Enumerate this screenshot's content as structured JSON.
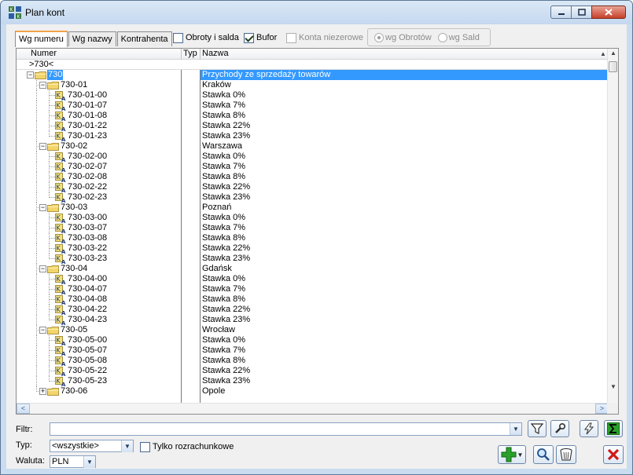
{
  "window": {
    "title": "Plan kont",
    "icon": "app-grid-icon"
  },
  "tabs": [
    {
      "label": "Wg numeru",
      "active": true
    },
    {
      "label": "Wg nazwy",
      "active": false
    },
    {
      "label": "Kontrahenta",
      "active": false
    }
  ],
  "options": {
    "obroty": {
      "label": "Obroty i salda",
      "checked": false
    },
    "bufor": {
      "label": "Bufor",
      "checked": true
    },
    "niezerowe": {
      "label": "Konta niezerowe",
      "checked": false,
      "disabled": true
    },
    "wg_obrotow": {
      "label": "wg Obrotów",
      "selected": true,
      "disabled": true
    },
    "wg_sald": {
      "label": "wg Sald",
      "selected": false,
      "disabled": true
    }
  },
  "grid": {
    "columns": {
      "numer": "Numer",
      "typ": "Typ",
      "nazwa": "Nazwa"
    },
    "filter_value": ">730<",
    "rows": [
      {
        "level": 0,
        "kind": "folder",
        "expander": "−",
        "numer": "730",
        "nazwa": "Przychody ze sprzedaży towarów",
        "selected": true
      },
      {
        "level": 1,
        "kind": "folder",
        "expander": "−",
        "numer": "730-01",
        "nazwa": "Kraków"
      },
      {
        "level": 2,
        "kind": "account",
        "numer": "730-01-00",
        "nazwa": "Stawka 0%"
      },
      {
        "level": 2,
        "kind": "account",
        "numer": "730-01-07",
        "nazwa": "Stawka 7%"
      },
      {
        "level": 2,
        "kind": "account",
        "numer": "730-01-08",
        "nazwa": "Stawka 8%"
      },
      {
        "level": 2,
        "kind": "account",
        "numer": "730-01-22",
        "nazwa": "Stawka 22%"
      },
      {
        "level": 2,
        "kind": "account",
        "numer": "730-01-23",
        "nazwa": "Stawka 23%",
        "last": true
      },
      {
        "level": 1,
        "kind": "folder",
        "expander": "−",
        "numer": "730-02",
        "nazwa": "Warszawa"
      },
      {
        "level": 2,
        "kind": "account",
        "numer": "730-02-00",
        "nazwa": "Stawka 0%"
      },
      {
        "level": 2,
        "kind": "account",
        "numer": "730-02-07",
        "nazwa": "Stawka 7%"
      },
      {
        "level": 2,
        "kind": "account",
        "numer": "730-02-08",
        "nazwa": "Stawka 8%"
      },
      {
        "level": 2,
        "kind": "account",
        "numer": "730-02-22",
        "nazwa": "Stawka 22%"
      },
      {
        "level": 2,
        "kind": "account",
        "numer": "730-02-23",
        "nazwa": "Stawka 23%",
        "last": true
      },
      {
        "level": 1,
        "kind": "folder",
        "expander": "−",
        "numer": "730-03",
        "nazwa": "Poznań"
      },
      {
        "level": 2,
        "kind": "account",
        "numer": "730-03-00",
        "nazwa": "Stawka 0%"
      },
      {
        "level": 2,
        "kind": "account",
        "numer": "730-03-07",
        "nazwa": "Stawka 7%"
      },
      {
        "level": 2,
        "kind": "account",
        "numer": "730-03-08",
        "nazwa": "Stawka 8%"
      },
      {
        "level": 2,
        "kind": "account",
        "numer": "730-03-22",
        "nazwa": "Stawka 22%"
      },
      {
        "level": 2,
        "kind": "account",
        "numer": "730-03-23",
        "nazwa": "Stawka 23%",
        "last": true
      },
      {
        "level": 1,
        "kind": "folder",
        "expander": "−",
        "numer": "730-04",
        "nazwa": "Gdańsk"
      },
      {
        "level": 2,
        "kind": "account",
        "numer": "730-04-00",
        "nazwa": "Stawka 0%"
      },
      {
        "level": 2,
        "kind": "account",
        "numer": "730-04-07",
        "nazwa": "Stawka 7%"
      },
      {
        "level": 2,
        "kind": "account",
        "numer": "730-04-08",
        "nazwa": "Stawka 8%"
      },
      {
        "level": 2,
        "kind": "account",
        "numer": "730-04-22",
        "nazwa": "Stawka 22%"
      },
      {
        "level": 2,
        "kind": "account",
        "numer": "730-04-23",
        "nazwa": "Stawka 23%",
        "last": true
      },
      {
        "level": 1,
        "kind": "folder",
        "expander": "−",
        "numer": "730-05",
        "nazwa": "Wrocław"
      },
      {
        "level": 2,
        "kind": "account",
        "numer": "730-05-00",
        "nazwa": "Stawka 0%"
      },
      {
        "level": 2,
        "kind": "account",
        "numer": "730-05-07",
        "nazwa": "Stawka 7%"
      },
      {
        "level": 2,
        "kind": "account",
        "numer": "730-05-08",
        "nazwa": "Stawka 8%"
      },
      {
        "level": 2,
        "kind": "account",
        "numer": "730-05-22",
        "nazwa": "Stawka 22%"
      },
      {
        "level": 2,
        "kind": "account",
        "numer": "730-05-23",
        "nazwa": "Stawka 23%",
        "last": true
      },
      {
        "level": 1,
        "kind": "folder",
        "expander": "+",
        "numer": "730-06",
        "nazwa": "Opole",
        "last": true
      }
    ]
  },
  "bottom": {
    "filtr_label": "Filtr:",
    "filtr_value": "",
    "typ_label": "Typ:",
    "typ_value": "<wszystkie>",
    "tylko_label": "Tylko rozrachunkowe",
    "tylko_checked": false,
    "waluta_label": "Waluta:",
    "waluta_value": "PLN"
  },
  "colors": {
    "selection": "#3399ff",
    "window_frame": "#c9dcf0",
    "folder": "#f2d56b",
    "close_red": "#d01818",
    "add_green": "#2aa12a"
  }
}
